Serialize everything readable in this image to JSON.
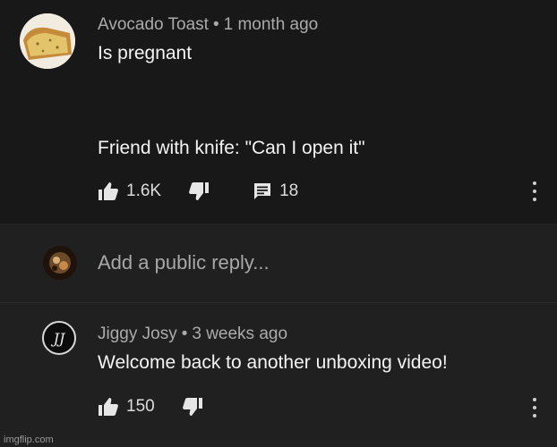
{
  "top_comment": {
    "author": "Avocado Toast",
    "separator": "•",
    "time": "1 month ago",
    "line1": "Is pregnant",
    "line2": "Friend with knife: \"Can I open it\"",
    "likes": "1.6K",
    "replies": "18",
    "avatar_icon": "banana-bread-avatar"
  },
  "reply_input": {
    "placeholder": "Add a public reply...",
    "avatar_icon": "user-avatar"
  },
  "reply_comment": {
    "author": "Jiggy Josy",
    "separator": "•",
    "time": "3 weeks ago",
    "text": "Welcome back to another unboxing video!",
    "likes": "150",
    "avatar_letters": "JJ"
  },
  "watermark": "imgflip.com",
  "colors": {
    "background": "#181818",
    "reply_background": "#202020",
    "meta_text": "#aaaaaa",
    "body_text": "#f4f4f4"
  }
}
